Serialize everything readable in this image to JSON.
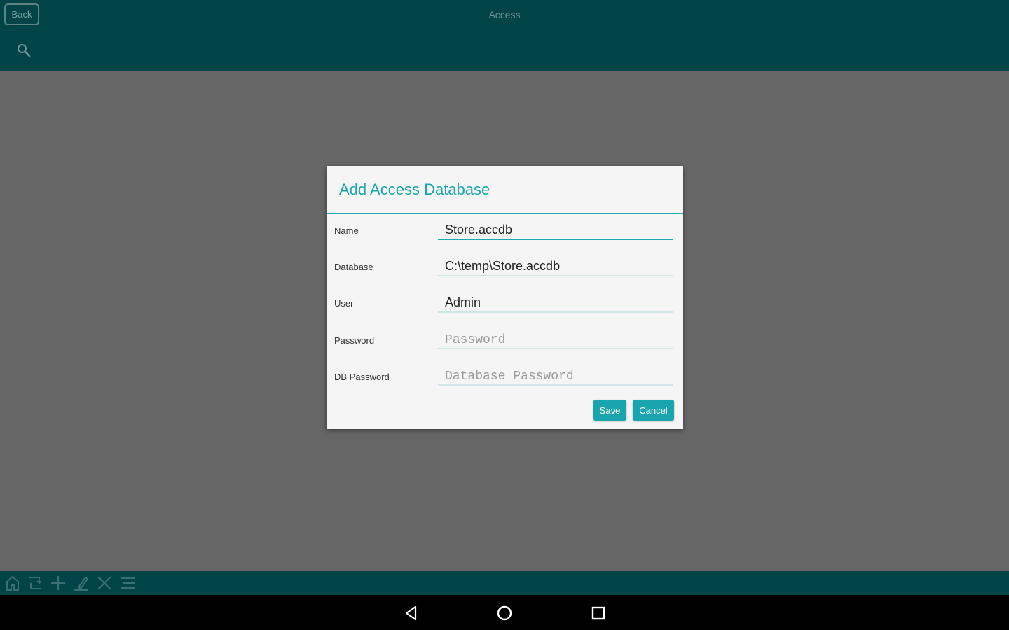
{
  "header": {
    "back_label": "Back",
    "title": "Access"
  },
  "dialog": {
    "title": "Add Access Database",
    "fields": [
      {
        "label": "Name",
        "value": "Store.accdb",
        "placeholder": ""
      },
      {
        "label": "Database",
        "value": "C:\\temp\\Store.accdb",
        "placeholder": ""
      },
      {
        "label": "User",
        "value": "Admin",
        "placeholder": ""
      },
      {
        "label": "Password",
        "value": "",
        "placeholder": "Password"
      },
      {
        "label": "DB Password",
        "value": "",
        "placeholder": "Database Password"
      }
    ],
    "save_label": "Save",
    "cancel_label": "Cancel"
  },
  "toolbar": {
    "icons": [
      "home-icon",
      "refresh-icon",
      "add-icon",
      "edit-icon",
      "delete-icon",
      "menu-icon"
    ]
  },
  "navbar": {
    "icons": [
      "back-triangle-icon",
      "home-circle-icon",
      "recents-square-icon"
    ]
  },
  "colors": {
    "app_bar": "#004448",
    "accent": "#19a5ad",
    "scrim": "#666666",
    "dialog_bg": "#f5f5f5"
  }
}
